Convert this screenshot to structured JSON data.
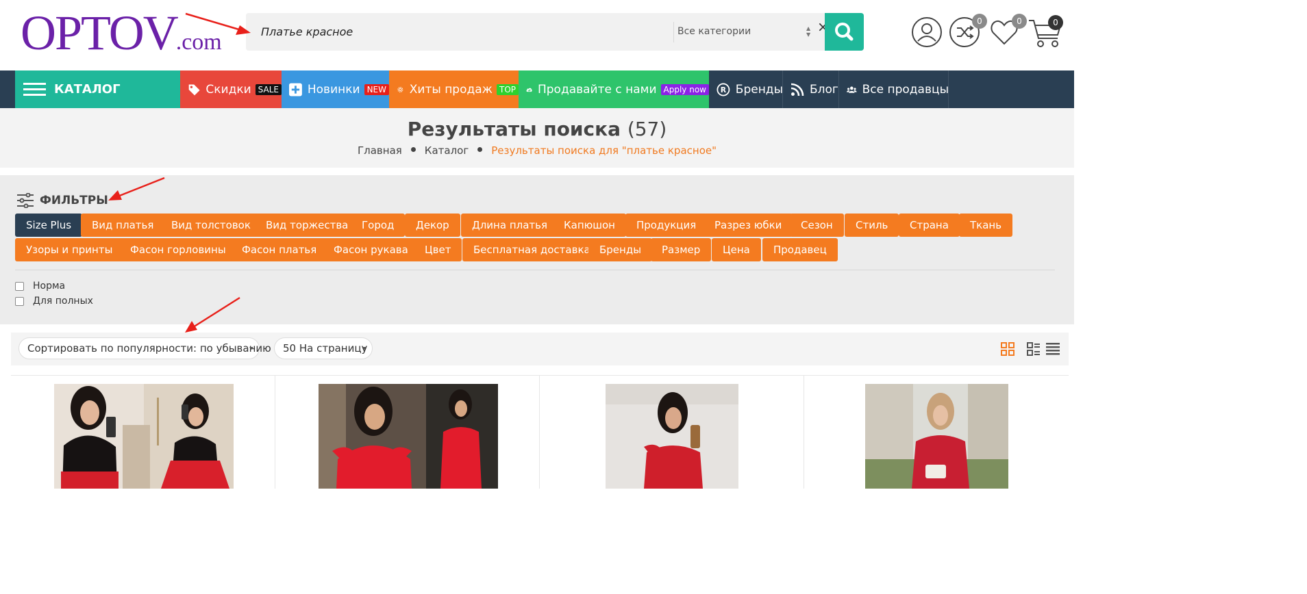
{
  "logo": {
    "main": "OPTOV",
    "suffix": ".com"
  },
  "search": {
    "query": "Платье красное",
    "category": "Все категории",
    "clear_symbol": "×"
  },
  "header": {
    "compare_count": "0",
    "wishlist_count": "0",
    "cart_count": "0"
  },
  "nav": {
    "catalog": "КАТАЛОГ",
    "sale": {
      "label": "Скидки",
      "badge": "SALE",
      "color": "#e8473b"
    },
    "new": {
      "label": "Новинки",
      "badge": "NEW",
      "color": "#3a97e0"
    },
    "top": {
      "label": "Хиты продаж",
      "badge": "TOP",
      "color": "#f47b20"
    },
    "sell": {
      "label": "Продавайте с нами",
      "badge": "Apply now",
      "color": "#2ec46b"
    },
    "brands": "Бренды",
    "blog": "Блог",
    "sellers": "Все продавцы",
    "catalog_color": "#1fb89a"
  },
  "page": {
    "title": "Результаты поиска",
    "count": "(57)",
    "breadcrumb": [
      "Главная",
      "Каталог",
      "Результаты поиска для \"платье красное\""
    ]
  },
  "filters": {
    "heading": "ФИЛЬТРЫ",
    "chips_row1": [
      "Size Plus",
      "Вид платья",
      "Вид толстовок",
      "Вид торжества",
      "Город",
      "Декор",
      "Длина платья",
      "Капюшон",
      "Продукция",
      "Разрез юбки",
      "Сезон",
      "Стиль",
      "Страна",
      "Ткань"
    ],
    "chips_row2": [
      "Узоры и принты",
      "Фасон горловины",
      "Фасон платья",
      "Фасон рукава",
      "Цвет",
      "Бесплатная доставка",
      "Бренды",
      "Размер",
      "Цена",
      "Продавец"
    ],
    "active_chip": "Size Plus",
    "options": [
      "Норма",
      "Для полных"
    ]
  },
  "sort": {
    "order": "Сортировать по популярности: по убыванию",
    "per_page": "50 На страницу"
  },
  "products": [
    "product-1",
    "product-2",
    "product-3",
    "product-4"
  ],
  "colors": {
    "accent": "#f47b20",
    "teal": "#1fb89a",
    "navy": "#2a3f53",
    "logo": "#6b21a8",
    "annotation": "#e8201a"
  }
}
